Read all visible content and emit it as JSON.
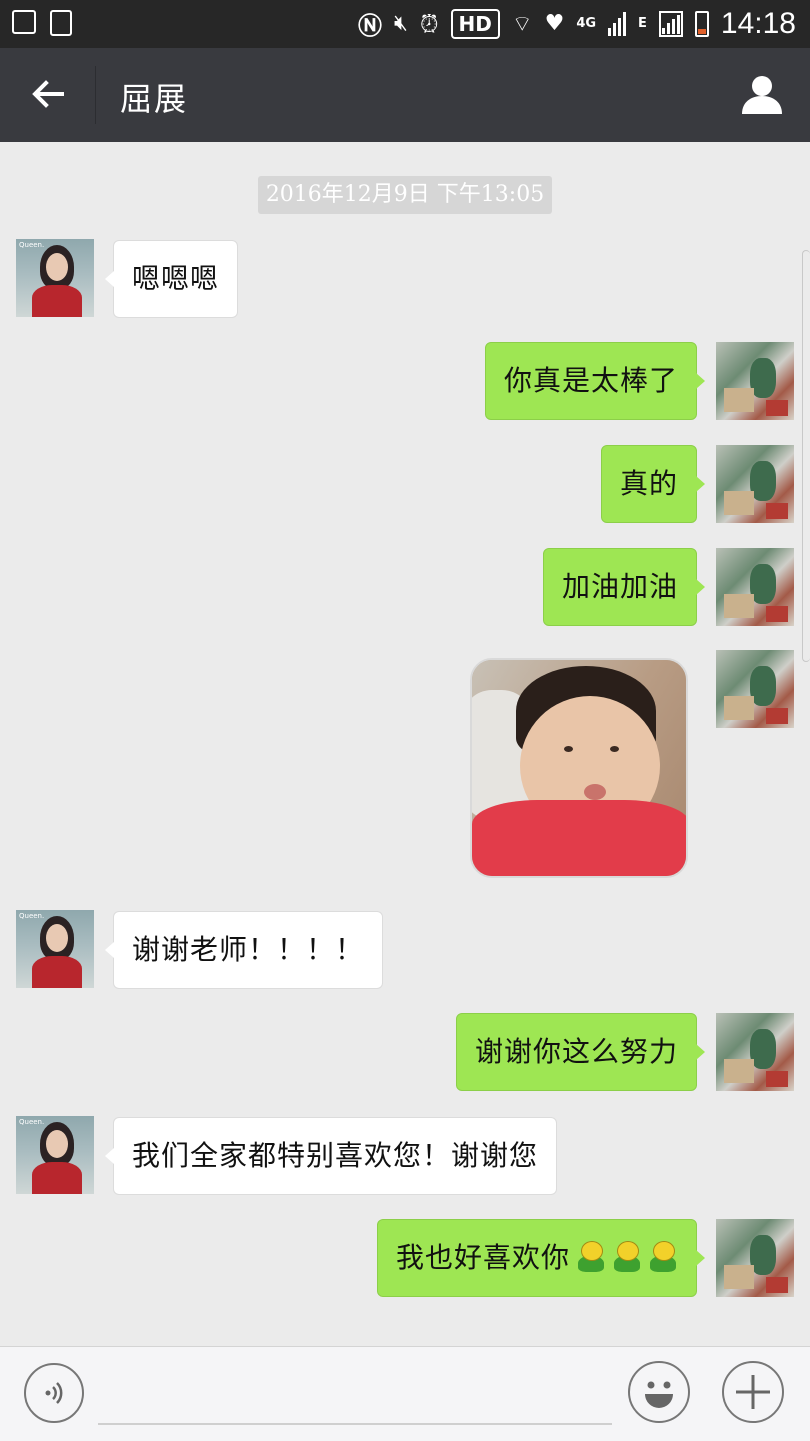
{
  "status_bar": {
    "network_type": "4G",
    "network_type_2": "E",
    "hd_label": "HD",
    "time": "14:18",
    "icons": [
      "gallery-icon",
      "screenshot-icon",
      "nfc-icon",
      "mute-icon",
      "alarm-icon",
      "hd-icon",
      "wifi-icon",
      "heart-shield-icon",
      "signal-icon",
      "signal-icon",
      "battery-icon"
    ]
  },
  "header": {
    "title": "屈展",
    "back_icon": "arrow-left-icon",
    "profile_icon": "person-icon"
  },
  "chat": {
    "timestamp": "2016年12月9日 下午13:05",
    "messages": [
      {
        "side": "in",
        "text": "嗯嗯嗯"
      },
      {
        "side": "out",
        "text": "你真是太棒了"
      },
      {
        "side": "out",
        "text": "真的"
      },
      {
        "side": "out",
        "text": "加油加油"
      },
      {
        "side": "out",
        "type": "image"
      },
      {
        "side": "in",
        "text": "谢谢老师！！！！"
      },
      {
        "side": "out",
        "text": "谢谢你这么努力"
      },
      {
        "side": "in",
        "text": "我们全家都特别喜欢您！谢谢您"
      },
      {
        "side": "out",
        "text": "我也好喜欢你",
        "emoji_count": 3
      }
    ],
    "avatar_tag": "Queen.",
    "colors": {
      "sent_bubble": "#9ee653",
      "received_bubble": "#ffffff",
      "background": "#ebebeb",
      "navbar": "#393a3f"
    }
  },
  "input_bar": {
    "voice_icon": "voice-icon",
    "emoji_icon": "smiley-icon",
    "plus_icon": "plus-icon"
  }
}
